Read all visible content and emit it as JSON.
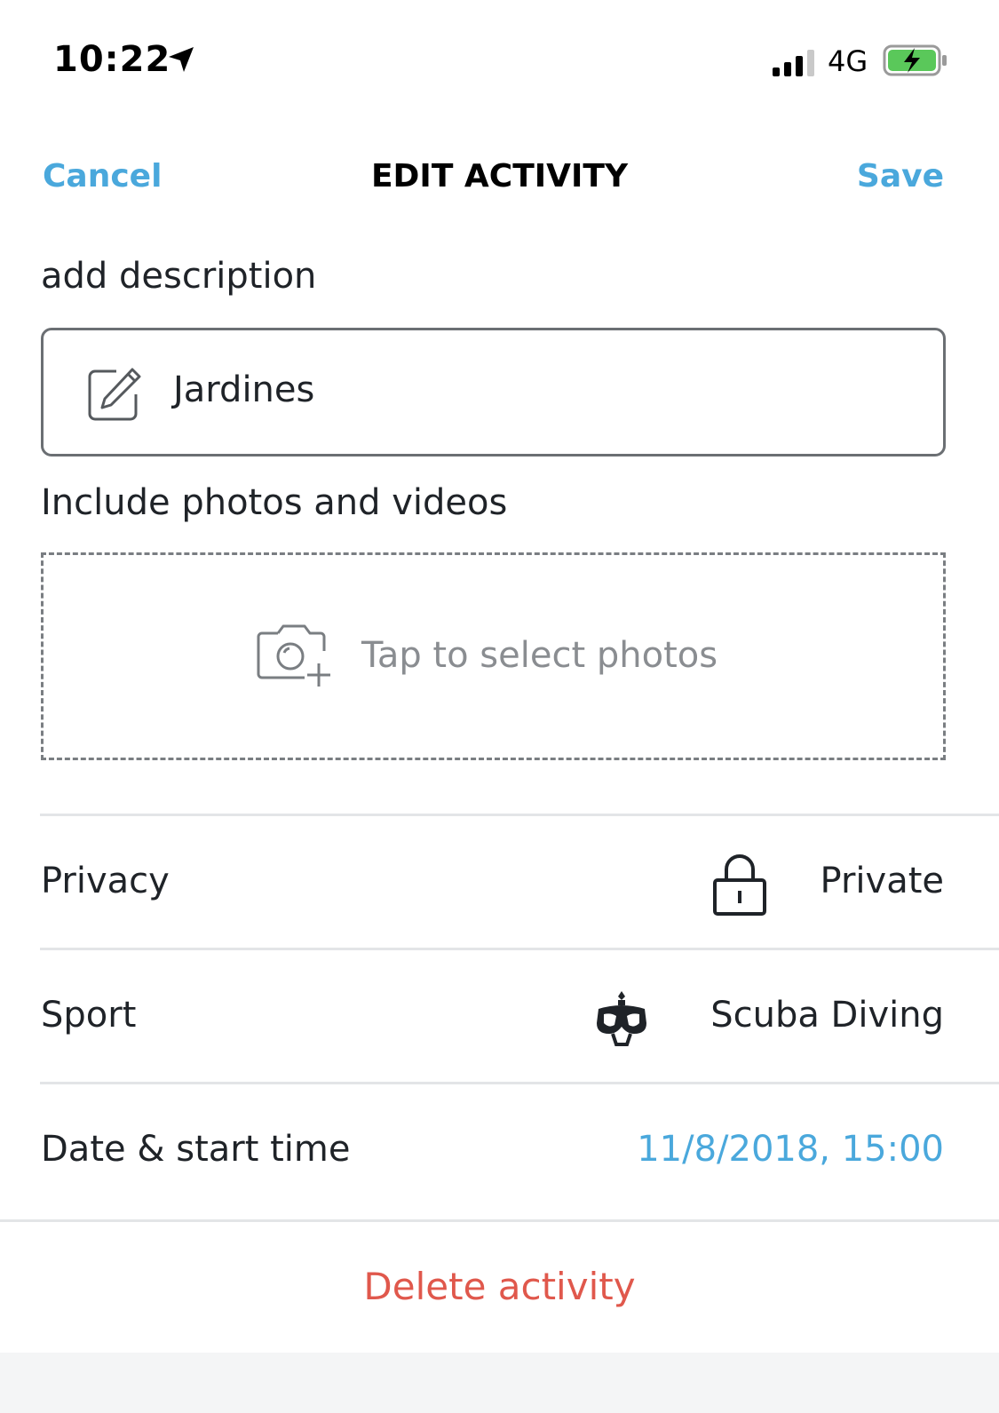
{
  "status_bar": {
    "time": "10:22",
    "network": "4G",
    "battery_color": "#5ac85a"
  },
  "nav": {
    "cancel_label": "Cancel",
    "title": "EDIT ACTIVITY",
    "save_label": "Save",
    "accent_color": "#4aa8dc"
  },
  "description": {
    "label": "add description",
    "value": "Jardines",
    "icon": "edit-icon"
  },
  "photos": {
    "label": "Include photos and videos",
    "placeholder": "Tap to select photos",
    "icon": "camera-add-icon"
  },
  "settings": {
    "privacy": {
      "label": "Privacy",
      "value": "Private",
      "icon": "lock-icon"
    },
    "sport": {
      "label": "Sport",
      "value": "Scuba Diving",
      "icon": "scuba-mask-icon"
    },
    "date": {
      "label": "Date & start time",
      "value": "11/8/2018, 15:00"
    }
  },
  "actions": {
    "delete_label": "Delete activity",
    "delete_color": "#e0584c"
  }
}
